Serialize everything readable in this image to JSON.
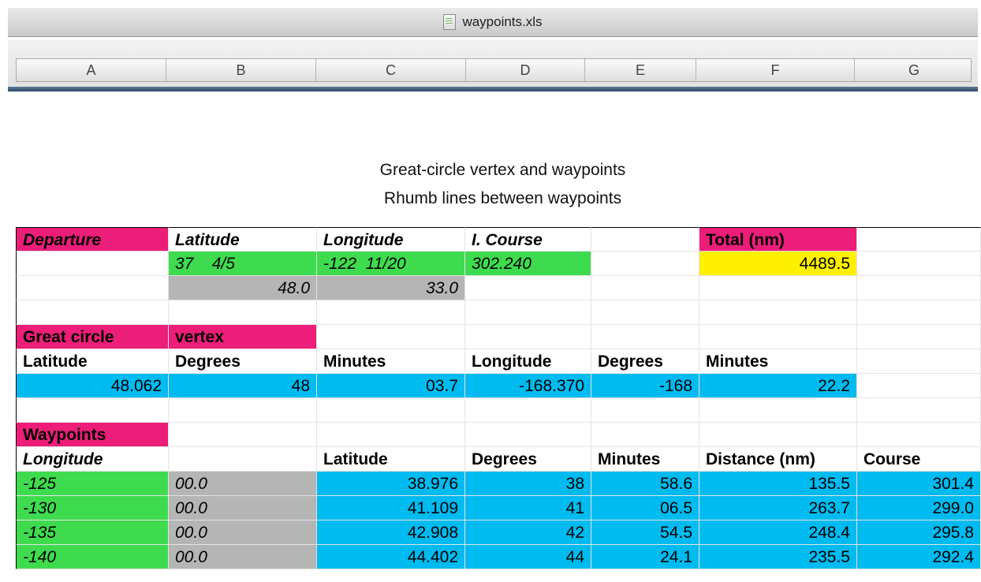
{
  "window": {
    "title": "waypoints.xls"
  },
  "columns": [
    "A",
    "B",
    "C",
    "D",
    "E",
    "F",
    "G"
  ],
  "heading": {
    "line1": "Great-circle vertex and waypoints",
    "line2": "Rhumb lines between waypoints"
  },
  "departure": {
    "label": "Departure",
    "lat_header": "Latitude",
    "lon_header": "Longitude",
    "course_header": "I. Course",
    "total_header": "Total (nm)",
    "lat_deg": "37",
    "lat_frac": "4/5",
    "lon_deg": "-122",
    "lon_frac": "11/20",
    "course": "302.240",
    "total": "4489.5",
    "lat_min": "48.0",
    "lon_min": "33.0"
  },
  "vertex": {
    "label": "Great circle",
    "label2": "vertex",
    "headers": [
      "Latitude",
      "Degrees",
      "Minutes",
      "Longitude",
      "Degrees",
      "Minutes"
    ],
    "values": [
      "48.062",
      "48",
      "03.7",
      "-168.370",
      "-168",
      "22.2"
    ]
  },
  "waypoints": {
    "label": "Waypoints",
    "headers": [
      "Longitude",
      "",
      "Latitude",
      "Degrees",
      "Minutes",
      "Distance (nm)",
      "Course"
    ],
    "rows": [
      [
        "-125",
        "00.0",
        "38.976",
        "38",
        "58.6",
        "135.5",
        "301.4"
      ],
      [
        "-130",
        "00.0",
        "41.109",
        "41",
        "06.5",
        "263.7",
        "299.0"
      ],
      [
        "-135",
        "00.0",
        "42.908",
        "42",
        "54.5",
        "248.4",
        "295.8"
      ],
      [
        "-140",
        "00.0",
        "44.402",
        "44",
        "24.1",
        "235.5",
        "292.4"
      ]
    ]
  }
}
